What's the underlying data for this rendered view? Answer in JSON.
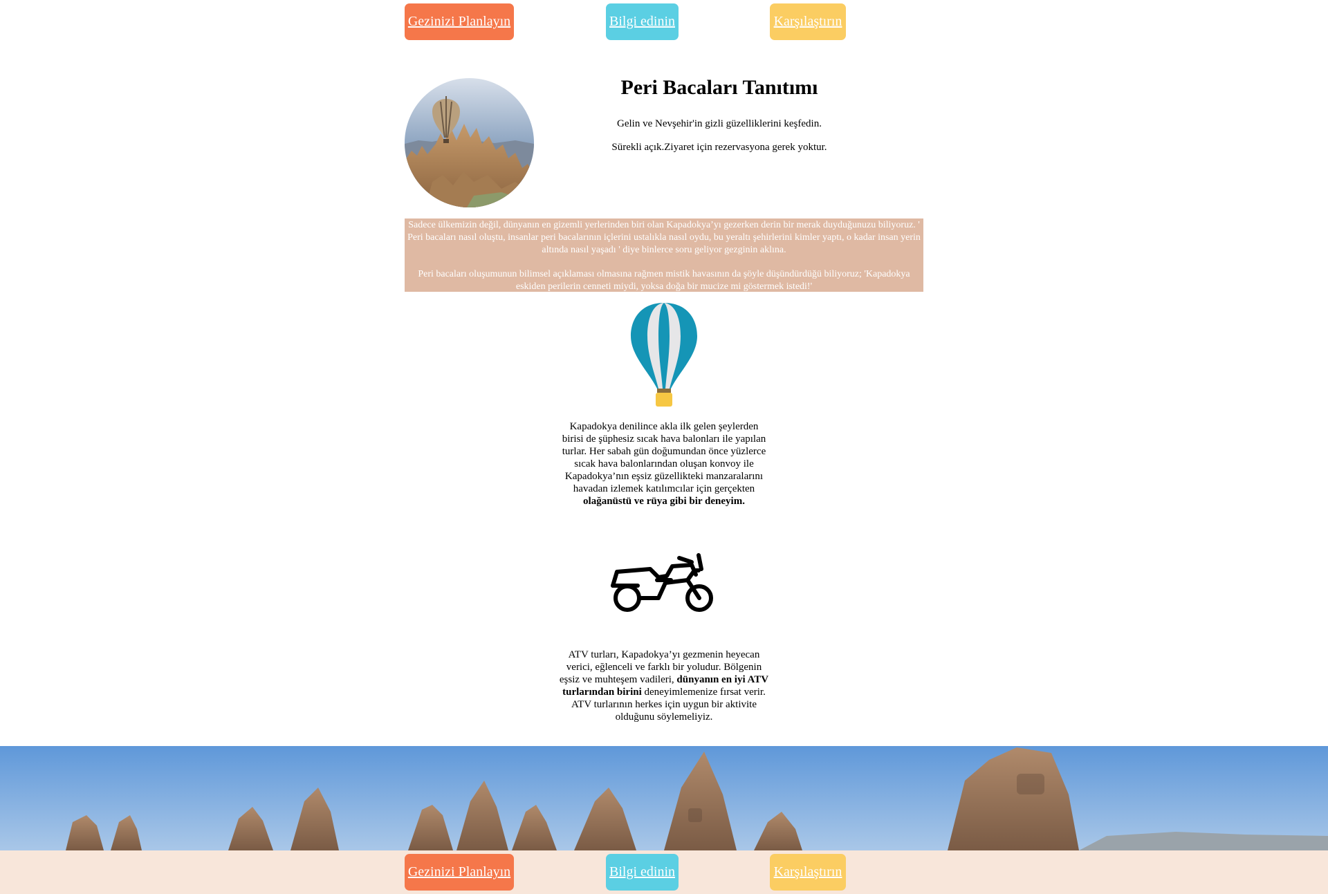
{
  "nav": {
    "plan_label": "Gezinizi Planlayın",
    "info_label": "Bilgi edinin",
    "compare_label": "Karşılaştırın"
  },
  "hero": {
    "title": "Peri Bacaları Tanıtımı",
    "subtitle_1": "Gelin ve Nevşehir'in gizli güzelliklerini keşfedin.",
    "subtitle_2": "Sürekli açık.Ziyaret için rezervasyona gerek yoktur."
  },
  "intro": {
    "paragraph_1": "Sadece ülkemizin değil, dünyanın en gizemli yerlerinden biri olan Kapadokya’yı gezerken derin bir merak duyduğunuzu biliyoruz. ' Peri bacaları nasıl oluştu, insanlar peri bacalarının içlerini ustalıkla nasıl oydu, bu yeraltı şehirlerini kimler yaptı, o kadar insan yerin altında nasıl yaşadı ' diye binlerce soru geliyor gezginin aklına.",
    "paragraph_2": "Peri bacaları oluşumunun bilimsel açıklaması olmasına rağmen mistik havasının da şöyle düşündürdüğü biliyoruz; 'Kapadokya eskiden perilerin cenneti miydi, yoksa doğa bir mucize mi göstermek istedi!'"
  },
  "balloon_section": {
    "icon": "hot-air-balloon-icon",
    "text": "Kapadokya denilince akla ilk gelen şeylerden birisi de şüphesiz sıcak hava balonları ile yapılan turlar. Her sabah gün doğumundan önce yüzlerce sıcak hava balonlarından oluşan konvoy ile Kapadokya’nın eşsiz güzellikteki manzaralarını havadan izlemek katılımcılar için gerçekten",
    "bold": "olağanüstü ve rüya gibi bir deneyim."
  },
  "atv_section": {
    "icon": "atv-icon",
    "text_before": "ATV turları, Kapadokya’yı gezmenin heyecan verici, eğlenceli ve farklı bir yoludur. Bölgenin eşsiz ve muhteşem vadileri,",
    "bold": "dünyanın en iyi ATV turlarından birini",
    "text_after": "deneyimlemenize fırsat verir. ATV turlarının herkes için uygun bir aktivite olduğunu söylemeliyiz."
  },
  "colors": {
    "plan": "#f5774a",
    "info": "#5bcfe3",
    "compare": "#fbcd62",
    "intro_bg": "#dfb9a3",
    "footer_bg": "#f8e6da"
  }
}
